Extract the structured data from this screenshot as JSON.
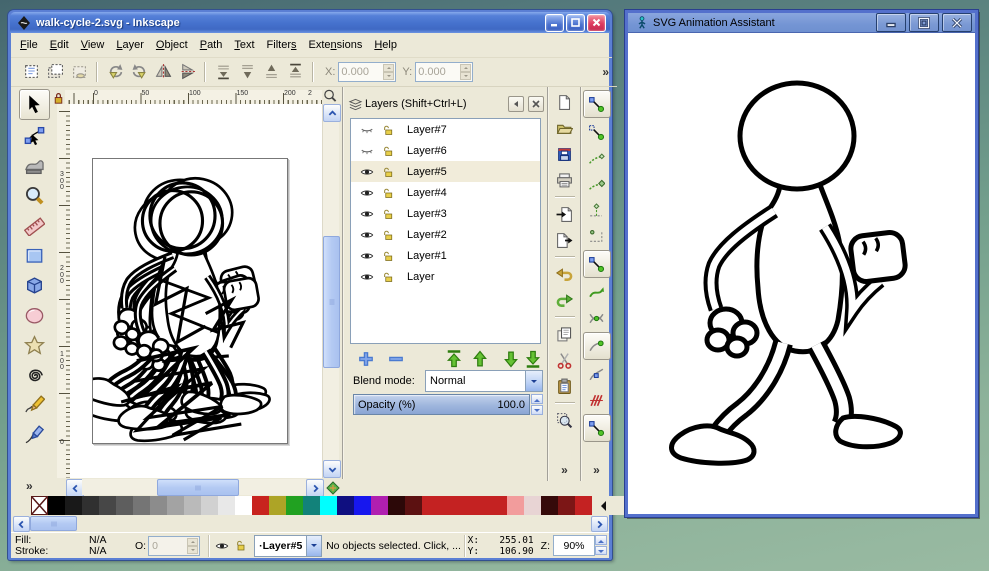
{
  "inkscape": {
    "title": "walk-cycle-2.svg - Inkscape",
    "menus": [
      {
        "label": "File",
        "accel": 0
      },
      {
        "label": "Edit",
        "accel": 0
      },
      {
        "label": "View",
        "accel": 0
      },
      {
        "label": "Layer",
        "accel": 0
      },
      {
        "label": "Object",
        "accel": 0
      },
      {
        "label": "Path",
        "accel": 0
      },
      {
        "label": "Text",
        "accel": 0
      },
      {
        "label": "Filters",
        "accel": 6
      },
      {
        "label": "Extensions",
        "accel": 4
      },
      {
        "label": "Help",
        "accel": 0
      }
    ],
    "toolbar": {
      "icons": [
        "select-all",
        "select-all-layers",
        "deselect",
        "sep",
        "rotate-ccw",
        "rotate-cw",
        "flip-h",
        "flip-v",
        "sep",
        "lower-bottom",
        "lower",
        "raise",
        "raise-top",
        "sep"
      ],
      "x_label": "X:",
      "x_value": "0.000",
      "y_label": "Y:",
      "y_value": "0.000",
      "overflow": "»"
    },
    "tools": [
      "selector",
      "node-editor",
      "tweak",
      "zoom-tool",
      "measure",
      "rect-tool",
      "box-3d",
      "ellipse-tool",
      "star-tool",
      "spiral",
      "pencil",
      "calligraphy"
    ],
    "ruler": {
      "h_numbers": [
        "0",
        "50",
        "100",
        "150",
        "200",
        "2"
      ],
      "v_numbers": [
        "300",
        "200",
        "100",
        "0"
      ]
    },
    "commands_icons": [
      "new-document",
      "open-document",
      "save-document",
      "print-document",
      "sep",
      "import-document",
      "export-document",
      "sep",
      "undo",
      "redo",
      "sep",
      "duplicate",
      "cut",
      "paste",
      "sep",
      "zoom-drawing"
    ],
    "snap_icons": [
      {
        "name": "snap-enabled",
        "framed": true
      },
      {
        "name": "snap-bbox",
        "framed": false
      },
      {
        "name": "snap-bbox-edges",
        "framed": false
      },
      {
        "name": "snap-bbox-corners",
        "framed": false
      },
      {
        "name": "snap-bbox-edge-midpoints",
        "framed": false
      },
      {
        "name": "snap-bbox-centers",
        "framed": false
      },
      {
        "name": "snap-nodes",
        "framed": true
      },
      {
        "name": "snap-paths",
        "framed": false
      },
      {
        "name": "snap-intersections",
        "framed": false
      },
      {
        "name": "snap-cusp-nodes",
        "framed": true
      },
      {
        "name": "snap-smooth-nodes",
        "framed": false
      },
      {
        "name": "snap-midpoints",
        "framed": false
      },
      {
        "name": "snap-others",
        "framed": true
      }
    ],
    "layers_panel": {
      "title": "Layers (Shift+Ctrl+L)",
      "rows": [
        {
          "label": "Layer#7",
          "visible": false,
          "selected": false
        },
        {
          "label": "Layer#6",
          "visible": false,
          "selected": false
        },
        {
          "label": "Layer#5",
          "visible": true,
          "selected": true
        },
        {
          "label": "Layer#4",
          "visible": true,
          "selected": false
        },
        {
          "label": "Layer#3",
          "visible": true,
          "selected": false
        },
        {
          "label": "Layer#2",
          "visible": true,
          "selected": false
        },
        {
          "label": "Layer#1",
          "visible": true,
          "selected": false
        },
        {
          "label": "Layer",
          "visible": true,
          "selected": false
        }
      ],
      "blend_label": "Blend mode:",
      "blend_value": "Normal",
      "opacity_label": "Opacity (%)",
      "opacity_value": "100.0"
    },
    "palette_colors": [
      "none",
      "#000000",
      "#191919",
      "#303030",
      "#474747",
      "#5e5e5e",
      "#757575",
      "#8c8c8c",
      "#a3a3a3",
      "#bababa",
      "#d1d1d1",
      "#e8e8e8",
      "#ffffff",
      "#c8231e",
      "#ada426",
      "#21a121",
      "#12827a",
      "#00ffff",
      "#0f0f80",
      "#1717ee",
      "#b01fb0",
      "#2c0808",
      "#5c1111",
      "#c42222",
      "#c42222",
      "#c42222",
      "#c42222",
      "#c42222",
      "#f29c9c",
      "#e8d4d4",
      "#360a0a",
      "#7c1616",
      "#c42222"
    ],
    "statusbar": {
      "fill_label": "Fill:",
      "fill_value": "N/A",
      "stroke_label": "Stroke:",
      "stroke_value": "N/A",
      "o_label": "O:",
      "o_value": "0",
      "layer_combo": "·Layer#5",
      "message": "No objects selected. Click, ...",
      "x_label": "X:",
      "x_value": "255.01",
      "y_label": "Y:",
      "y_value": "106.90",
      "z_label": "Z:",
      "zoom_value": "90%"
    }
  },
  "assistant": {
    "title": "SVG Animation Assistant"
  }
}
